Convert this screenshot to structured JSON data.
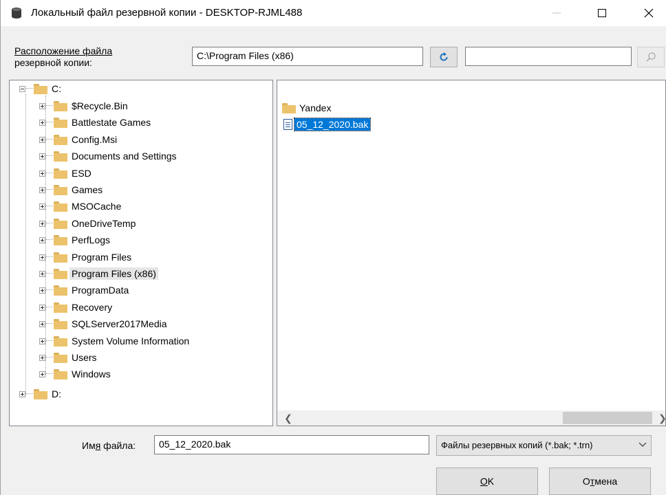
{
  "window": {
    "title": "Локальный файл резервной копии - DESKTOP-RJML488",
    "title_icon": "database-icon"
  },
  "location": {
    "label_line1": "Расположение файла",
    "label_line2": "резервной копии:",
    "path": "C:\\Program Files (x86)",
    "search_value": ""
  },
  "tree": {
    "root_c": "C:",
    "root_d": "D:",
    "folders": [
      "$Recycle.Bin",
      "Battlestate Games",
      "Config.Msi",
      "Documents and Settings",
      "ESD",
      "Games",
      "MSOCache",
      "OneDriveTemp",
      "PerfLogs",
      "Program Files",
      "Program Files (x86)",
      "ProgramData",
      "Recovery",
      "SQLServer2017Media",
      "System Volume Information",
      "Users",
      "Windows"
    ],
    "selected": "Program Files (x86)"
  },
  "files": {
    "items": [
      {
        "name": "Yandex",
        "type": "folder"
      },
      {
        "name": "05_12_2020.bak",
        "type": "file"
      }
    ],
    "selected": "05_12_2020.bak"
  },
  "bottom": {
    "filename_label_pre": "Им",
    "filename_label_ul": "я",
    "filename_label_post": " файла:",
    "filename_value": "05_12_2020.bak",
    "filter_value": "Файлы резервных копий (*.bak; *.trn)",
    "ok_ul": "O",
    "ok_rest": "K",
    "cancel_pre": "О",
    "cancel_ul": "т",
    "cancel_post": "мена"
  },
  "colors": {
    "selection": "#0078d7",
    "folder": "#ecc36c"
  }
}
